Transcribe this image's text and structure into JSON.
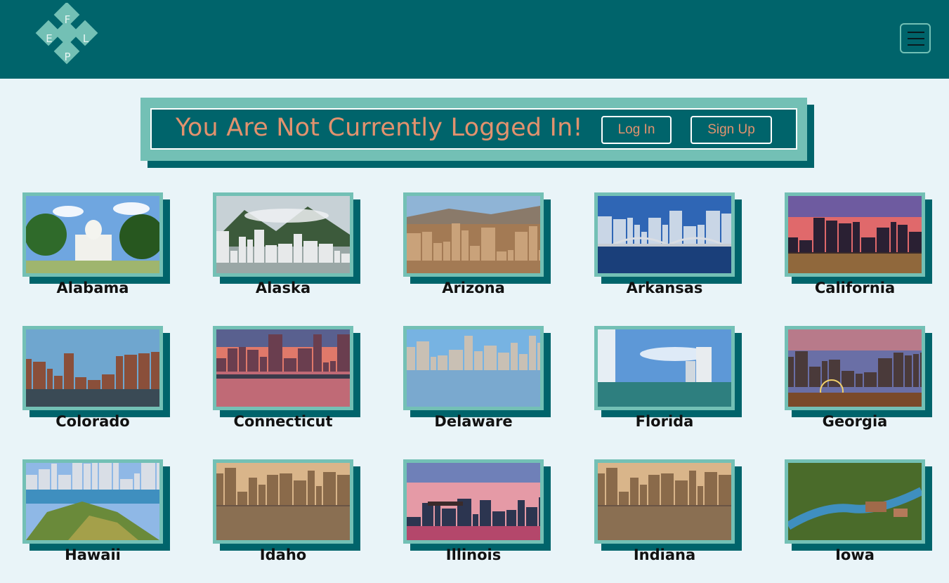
{
  "header": {
    "logo_letters": [
      "F",
      "E",
      "L",
      "P"
    ],
    "menu_icon": "hamburger-menu-icon"
  },
  "banner": {
    "message": "You Are Not Currently Logged In!",
    "login_label": "Log In",
    "signup_label": "Sign Up"
  },
  "colors": {
    "header_bg": "#00646b",
    "accent": "#73c0b5",
    "banner_text": "#e2926e",
    "page_bg": "#e9f4f8"
  },
  "states": [
    {
      "name": "Alabama",
      "scene": "capitol-building"
    },
    {
      "name": "Alaska",
      "scene": "mountain-town"
    },
    {
      "name": "Arizona",
      "scene": "desert-city"
    },
    {
      "name": "Arkansas",
      "scene": "river-bridge-skyline"
    },
    {
      "name": "California",
      "scene": "sunset-palms-city"
    },
    {
      "name": "Colorado",
      "scene": "city-skyline-dusk"
    },
    {
      "name": "Connecticut",
      "scene": "sunset-river-skyline"
    },
    {
      "name": "Delaware",
      "scene": "river-reflection-city"
    },
    {
      "name": "Florida",
      "scene": "coastal-towers"
    },
    {
      "name": "Georgia",
      "scene": "night-skyline-wheel"
    },
    {
      "name": "Hawaii",
      "scene": "diamond-head-crater"
    },
    {
      "name": "Idaho",
      "scene": "golden-hour-city"
    },
    {
      "name": "Illinois",
      "scene": "bridge-skyline-sunset"
    },
    {
      "name": "Indiana",
      "scene": "golden-hour-city"
    },
    {
      "name": "Iowa",
      "scene": "river-aerial-campus"
    }
  ]
}
